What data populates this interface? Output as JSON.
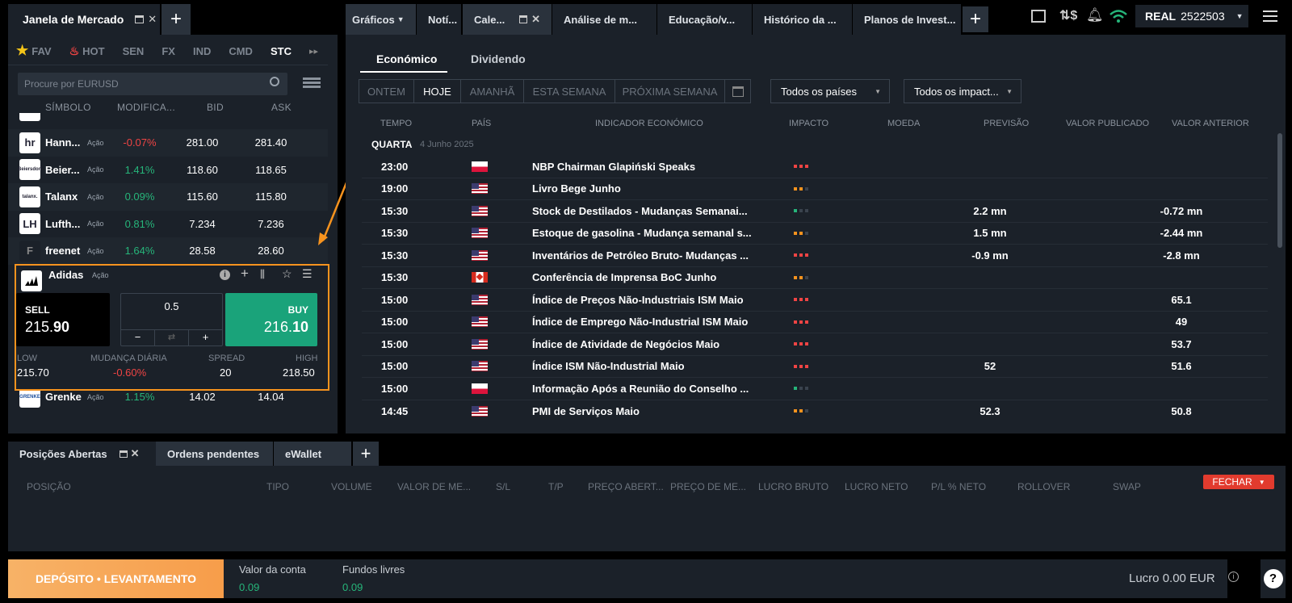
{
  "market": {
    "title": "Janela de Mercado",
    "categories": [
      "FAV",
      "HOT",
      "SEN",
      "FX",
      "IND",
      "CMD",
      "STC"
    ],
    "search_placeholder": "Procure por EURUSD",
    "columns": [
      "SÍMBOLO",
      "MODIFICA...",
      "BID",
      "ASK"
    ],
    "rows_top": [
      {
        "logo": "hr",
        "symbol": "Hann...",
        "tag": "Ação",
        "change": "-0.07%",
        "dir": "down",
        "bid": "281.00",
        "ask": "281.40"
      },
      {
        "logo": "Beiersdorf",
        "symbol": "Beier...",
        "tag": "Ação",
        "change": "1.41%",
        "dir": "up",
        "bid": "118.60",
        "ask": "118.65"
      },
      {
        "logo": "talanx.",
        "symbol": "Talanx",
        "tag": "Ação",
        "change": "0.09%",
        "dir": "up",
        "bid": "115.60",
        "ask": "115.80"
      },
      {
        "logo": "LH",
        "symbol": "Lufth...",
        "tag": "Ação",
        "change": "0.81%",
        "dir": "up",
        "bid": "7.234",
        "ask": "7.236"
      },
      {
        "logo": "F",
        "symbol": "freenet",
        "tag": "Ação",
        "change": "1.64%",
        "dir": "up",
        "bid": "28.58",
        "ask": "28.60"
      }
    ],
    "card": {
      "symbol": "Adidas",
      "tag": "Ação",
      "sell_label": "SELL",
      "sell_main": "215.",
      "sell_big": "90",
      "buy_label": "BUY",
      "buy_main": "216.",
      "buy_big": "10",
      "volume": "0.5",
      "minus": "−",
      "plus": "+",
      "low_label": "LOW",
      "low": "215.70",
      "change_label": "MUDANÇA DIÁRIA",
      "change": "-0.60%",
      "spread_label": "SPREAD",
      "spread": "20",
      "high_label": "HIGH",
      "high": "218.50"
    },
    "row_bottom": {
      "logo": "GRENKE",
      "symbol": "Grenke",
      "tag": "Ação",
      "change": "1.15%",
      "dir": "up",
      "bid": "14.02",
      "ask": "14.04"
    }
  },
  "tabs": [
    "Gráficos",
    "Notí...",
    "Cale...",
    "Análise de m...",
    "Educação/v...",
    "Histórico da ...",
    "Planos de Invest..."
  ],
  "account": {
    "type": "REAL",
    "number": "2522503"
  },
  "calendar": {
    "subtabs": [
      "Económico",
      "Dividendo"
    ],
    "filters": [
      "ONTEM",
      "HOJE",
      "AMANHÃ",
      "ESTA SEMANA",
      "PRÓXIMA SEMANA"
    ],
    "countries_select": "Todos os países",
    "impact_select": "Todos os impact...",
    "columns": [
      "TEMPO",
      "PAÍS",
      "INDICADOR ECONÓMICO",
      "IMPACTO",
      "MOEDA",
      "PREVISÃO",
      "VALOR PUBLICADO",
      "VALOR ANTERIOR"
    ],
    "day": "QUARTA",
    "date": "4 Junho 2025",
    "events": [
      {
        "time": "23:00",
        "country": "pl",
        "name": "NBP Chairman Glapiński Speaks",
        "impact": 3,
        "forecast": "",
        "previous": ""
      },
      {
        "time": "19:00",
        "country": "us",
        "name": "Livro Bege Junho",
        "impact": 2,
        "forecast": "",
        "previous": ""
      },
      {
        "time": "15:30",
        "country": "us",
        "name": "Stock de Destilados - Mudanças Semanai...",
        "impact": 1,
        "forecast": "2.2 mn",
        "previous": "-0.72 mn"
      },
      {
        "time": "15:30",
        "country": "us",
        "name": "Estoque de gasolina - Mudança semanal s...",
        "impact": 2,
        "forecast": "1.5 mn",
        "previous": "-2.44 mn"
      },
      {
        "time": "15:30",
        "country": "us",
        "name": "Inventários de Petróleo Bruto- Mudanças ...",
        "impact": 3,
        "forecast": "-0.9 mn",
        "previous": "-2.8 mn"
      },
      {
        "time": "15:30",
        "country": "ca",
        "name": "Conferência de Imprensa BoC Junho",
        "impact": 2,
        "forecast": "",
        "previous": ""
      },
      {
        "time": "15:00",
        "country": "us",
        "name": "Índice de Preços Não-Industriais ISM Maio",
        "impact": 3,
        "forecast": "",
        "previous": "65.1"
      },
      {
        "time": "15:00",
        "country": "us",
        "name": "Índice de Emprego Não-Industrial ISM Maio",
        "impact": 3,
        "forecast": "",
        "previous": "49"
      },
      {
        "time": "15:00",
        "country": "us",
        "name": "Índice de Atividade de Negócios Maio",
        "impact": 3,
        "forecast": "",
        "previous": "53.7"
      },
      {
        "time": "15:00",
        "country": "us",
        "name": "Índice ISM Não-Industrial Maio",
        "impact": 3,
        "forecast": "52",
        "previous": "51.6"
      },
      {
        "time": "15:00",
        "country": "pl",
        "name": "Informação Após a Reunião do Conselho ...",
        "impact": 1,
        "forecast": "",
        "previous": ""
      },
      {
        "time": "14:45",
        "country": "us",
        "name": "PMI de Serviços Maio",
        "impact": 2,
        "forecast": "52.3",
        "previous": "50.8"
      }
    ]
  },
  "positions": {
    "tabs": [
      "Posições Abertas",
      "Ordens pendentes",
      "eWallet"
    ],
    "columns": [
      "POSIÇÃO",
      "TIPO",
      "VOLUME",
      "VALOR DE ME...",
      "S/L",
      "T/P",
      "PREÇO ABERT...",
      "PREÇO DE ME...",
      "LUCRO BRUTO",
      "LUCRO NETO",
      "P/L % NETO",
      "ROLLOVER",
      "SWAP"
    ],
    "close_label": "FECHAR"
  },
  "footer": {
    "deposit_label": "DEPÓSITO • LEVANTAMENTO",
    "account_value_label": "Valor da conta",
    "account_value": "0.09",
    "free_funds_label": "Fundos livres",
    "free_funds": "0.09",
    "profit": "Lucro 0.00 EUR"
  }
}
